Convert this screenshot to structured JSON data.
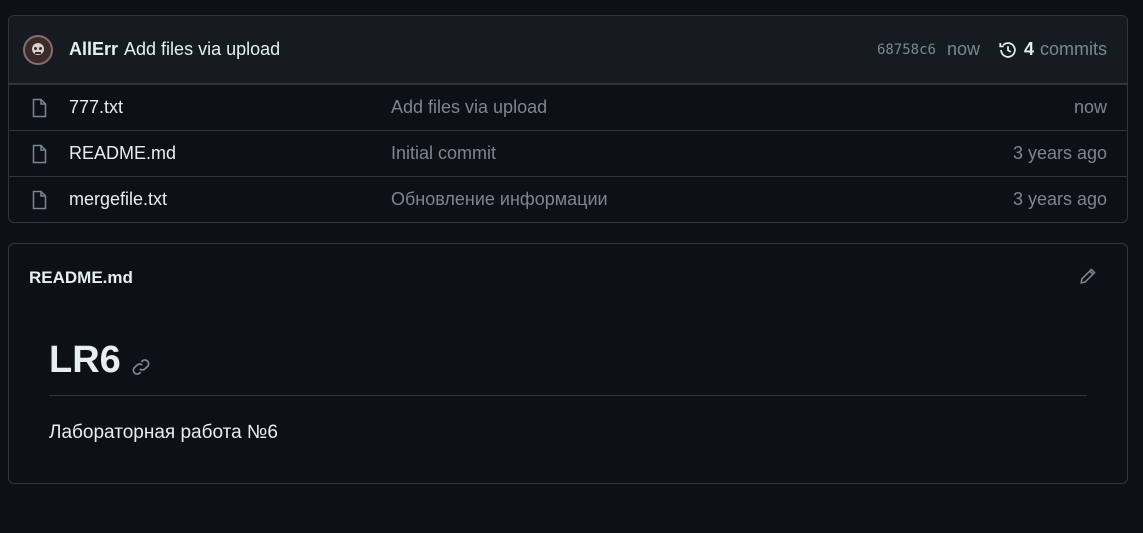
{
  "latest_commit": {
    "author": "AllErr",
    "message": "Add files via upload",
    "sha": "68758c6",
    "time": "now",
    "commit_count": "4",
    "commits_label": "commits",
    "history_icon": "history-icon"
  },
  "files": [
    {
      "name": "777.txt",
      "message": "Add files via upload",
      "age": "now",
      "icon": "file-icon"
    },
    {
      "name": "README.md",
      "message": "Initial commit",
      "age": "3 years ago",
      "icon": "file-icon"
    },
    {
      "name": "mergefile.txt",
      "message": "Обновление информации",
      "age": "3 years ago",
      "icon": "file-icon"
    }
  ],
  "readme": {
    "title": "README.md",
    "edit_icon": "pencil-icon",
    "heading": "LR6",
    "anchor_icon": "link-icon",
    "paragraph": "Лабораторная работа №6"
  },
  "colors": {
    "background": "#0d1117",
    "header_bg": "#161b22",
    "border": "#30363d",
    "muted": "#7d8590",
    "text": "#e6edf3"
  }
}
